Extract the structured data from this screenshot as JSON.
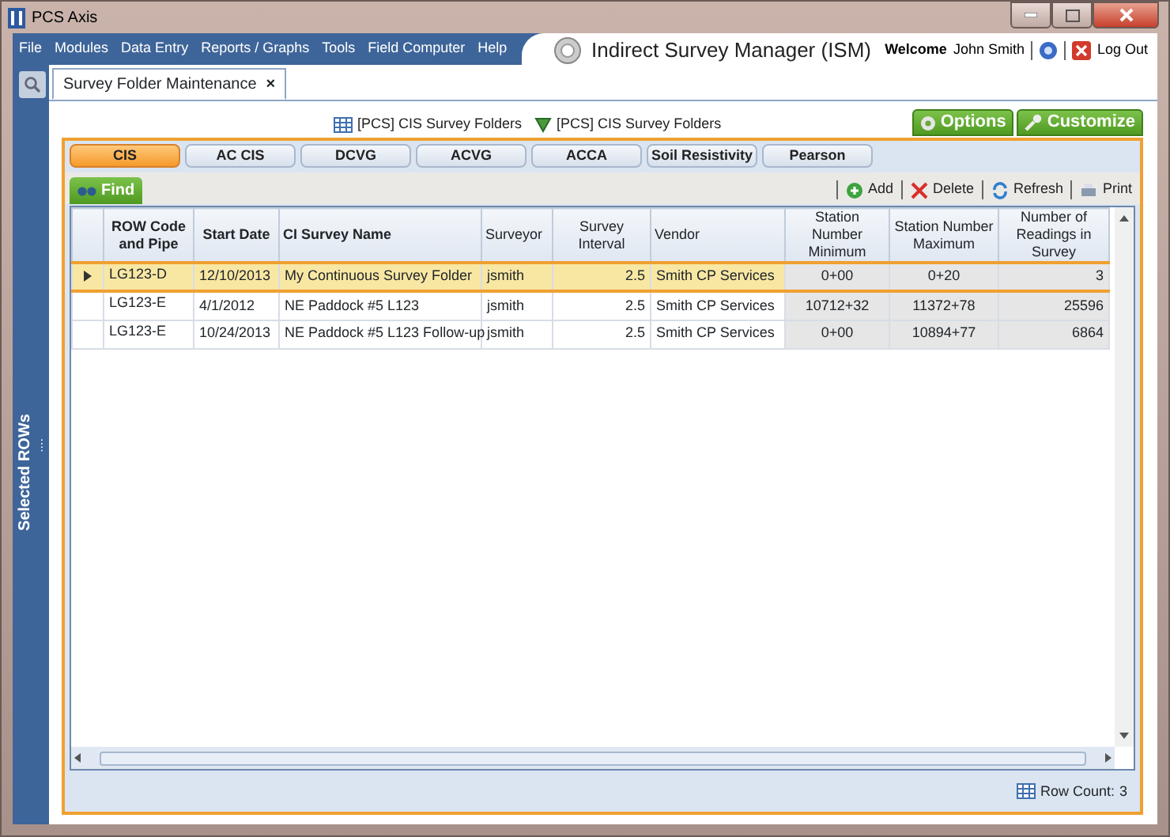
{
  "window": {
    "title": "PCS Axis"
  },
  "menu": [
    "File",
    "Modules",
    "Data Entry",
    "Reports / Graphs",
    "Tools",
    "Field Computer",
    "Help"
  ],
  "app_title": "Indirect Survey Manager (ISM)",
  "user": {
    "welcome": "Welcome",
    "name": "John Smith",
    "logout": "Log Out"
  },
  "sidebar": {
    "label": "Selected ROWs",
    "more": "...."
  },
  "document_tab": {
    "label": "Survey Folder Maintenance",
    "close": "×",
    "selected": true
  },
  "links": [
    "[PCS] CIS Survey Folders",
    "[PCS] CIS Survey Folders"
  ],
  "header_buttons": [
    "Options",
    "Customize"
  ],
  "survey_tabs": [
    {
      "label": "CIS",
      "selected": true
    },
    {
      "label": "AC CIS",
      "selected": false
    },
    {
      "label": "DCVG",
      "selected": false
    },
    {
      "label": "ACVG",
      "selected": false
    },
    {
      "label": "ACCA",
      "selected": false
    },
    {
      "label": "Soil Resistivity",
      "selected": false
    },
    {
      "label": "Pearson",
      "selected": false
    }
  ],
  "find_tab": "Find",
  "toolbar": [
    "Add",
    "Delete",
    "Refresh",
    "Print"
  ],
  "table": {
    "columns": [
      "ROW Code and Pipe",
      "Start Date",
      "CI Survey Name",
      "Surveyor",
      "Survey Interval",
      "Vendor",
      "Station Number Minimum",
      "Station Number Maximum",
      "Number of Readings in Survey"
    ],
    "rows": [
      {
        "selected": true,
        "cells": [
          "LG123-D",
          "12/10/2013",
          "My Continuous Survey Folder",
          "jsmith",
          "2.5",
          "Smith CP Services",
          "0+00",
          "0+20",
          "3"
        ]
      },
      {
        "selected": false,
        "cells": [
          "LG123-E",
          "4/1/2012",
          "NE Paddock #5 L123",
          "jsmith",
          "2.5",
          "Smith CP Services",
          "10712+32",
          "11372+78",
          "25596"
        ]
      },
      {
        "selected": false,
        "cells": [
          "LG123-E",
          "10/24/2013",
          "NE Paddock #5 L123 Follow-up",
          "jsmith",
          "2.5",
          "Smith CP Services",
          "0+00",
          "10894+77",
          "6864"
        ]
      }
    ]
  },
  "row_count": {
    "label": "Row Count:",
    "value": "3"
  }
}
